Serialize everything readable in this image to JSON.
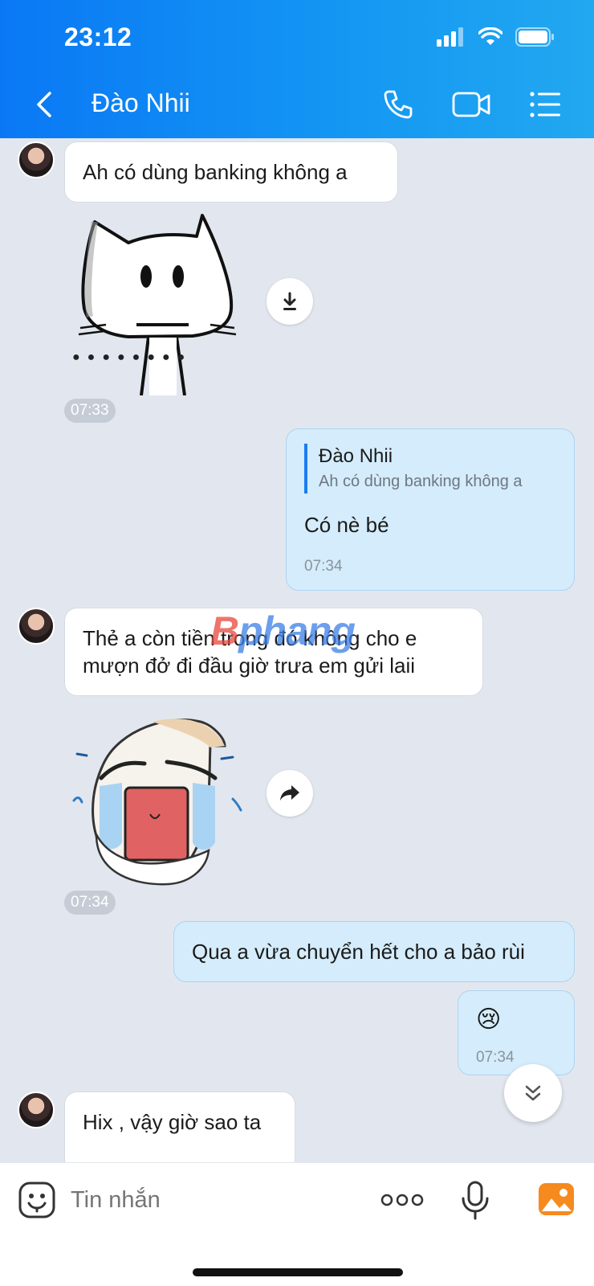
{
  "status_bar": {
    "time": "23:12"
  },
  "header": {
    "contact_name": "Đào Nhii"
  },
  "messages": {
    "m1": {
      "text": "Ah có dùng banking không a"
    },
    "sticker1": {
      "time": "07:33",
      "dots": "●●●●●●●●"
    },
    "reply": {
      "quote_name": "Đào Nhii",
      "quote_text": "Ah có dùng banking không a",
      "text": "Có nè bé",
      "time": "07:34"
    },
    "m2": {
      "text": "Thẻ a còn tiền trong đó không cho e mượn đở đi đầu giờ trưa em gửi laii"
    },
    "sticker2": {
      "time": "07:34"
    },
    "m3": {
      "text": "Qua a vừa chuyển hết cho a bảo rùi"
    },
    "m4": {
      "emoji": "😢",
      "time": "07:34"
    },
    "m5": {
      "text": "Hix , vậy giờ sao ta"
    }
  },
  "watermark": {
    "part1": "B",
    "part2": "phang"
  },
  "input": {
    "placeholder": "Tin nhắn"
  },
  "colors": {
    "header_start": "#0a78f5",
    "header_end": "#22a8f0",
    "my_bubble": "#d4ecfb",
    "chat_bg": "#e2e7ef"
  }
}
